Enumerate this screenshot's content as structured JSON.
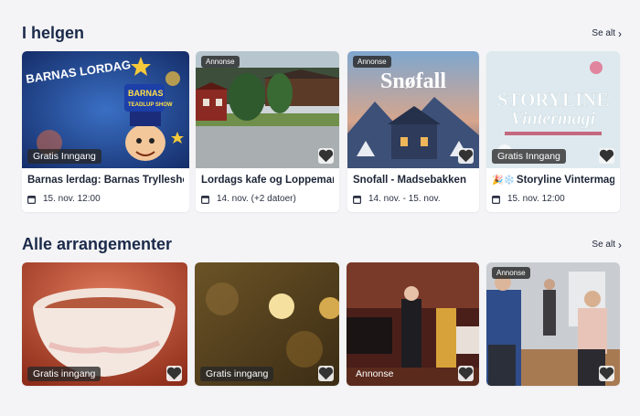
{
  "sections": {
    "weekend": {
      "title": "I helgen",
      "see_all": "Se alt"
    },
    "all": {
      "title": "Alle arrangementer",
      "see_all": "Se alt"
    }
  },
  "weekend_cards": [
    {
      "badge_top": "",
      "badge_bottom": "Gratis Inngang",
      "title": "Barnas lerdag: Barnas Tryllesho",
      "date": "15. nov. 12:00",
      "thumb_text": "BARNAS LORDAG"
    },
    {
      "badge_top": "Annonse",
      "badge_bottom": "",
      "title": "Lordags kafe og Loppemar",
      "date": "14. nov. (+2 datoer)"
    },
    {
      "badge_top": "Annonse",
      "badge_bottom": "",
      "title": "Snofall - Madsebakken",
      "date": "14. nov. - 15. nov.",
      "thumb_text": "Snøfall"
    },
    {
      "badge_top": "",
      "badge_bottom": "Gratis Inngang",
      "title": "Storyline Vintermagi",
      "title_prefix": "🎉❄️",
      "date": "15. nov. 12:00",
      "thumb_text_1": "STORYLINE",
      "thumb_text_2": "Vintermagi"
    }
  ],
  "all_cards": [
    {
      "badge_top": "",
      "badge_bottom": "Gratis inngang"
    },
    {
      "badge_top": "",
      "badge_bottom": "Gratis inngang"
    },
    {
      "badge_top": "",
      "badge_bottom": "Annonse"
    },
    {
      "badge_top": "Annonse",
      "badge_bottom": ""
    }
  ],
  "icons": {
    "favorite": "heart-icon",
    "date": "calendar-icon",
    "see_all": "chevron-right-icon"
  }
}
